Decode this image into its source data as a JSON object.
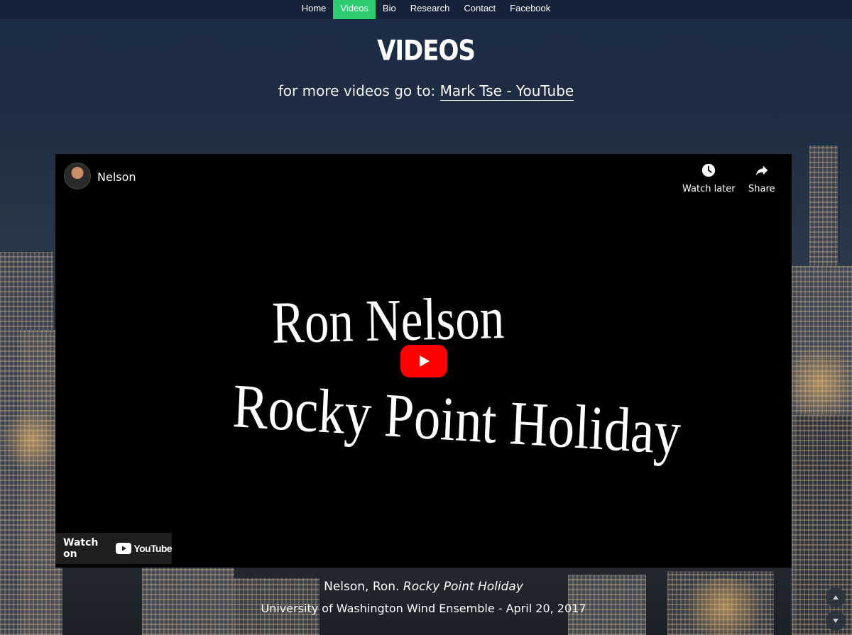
{
  "nav": {
    "items": [
      {
        "label": "Home",
        "active": false
      },
      {
        "label": "Videos",
        "active": true
      },
      {
        "label": "Bio",
        "active": false
      },
      {
        "label": "Research",
        "active": false
      },
      {
        "label": "Contact",
        "active": false
      },
      {
        "label": "Facebook",
        "active": false
      }
    ],
    "active_color": "#2ecc71"
  },
  "page": {
    "title": "VIDEOS",
    "subtitle_prefix": "for more videos go to: ",
    "subtitle_link": "Mark Tse - YouTube"
  },
  "player": {
    "channel_name": "Nelson",
    "watch_later_label": "Watch later",
    "share_label": "Share",
    "video_title_line1": "Ron Nelson",
    "video_title_line2": "Rocky Point Holiday",
    "watch_on_label": "Watch on",
    "youtube_wordmark": "YouTube",
    "play_color": "#ff0000"
  },
  "caption": {
    "line1_prefix": "Nelson, Ron. ",
    "line1_italic": "Rocky Point Holiday",
    "line2": "University of Washington Wind Ensemble - April 20, 2017"
  },
  "icons": {
    "watch_later": "clock-icon",
    "share": "share-arrow-icon",
    "play": "play-icon",
    "scroll_up": "chevron-up-icon",
    "scroll_down": "chevron-down-icon"
  }
}
